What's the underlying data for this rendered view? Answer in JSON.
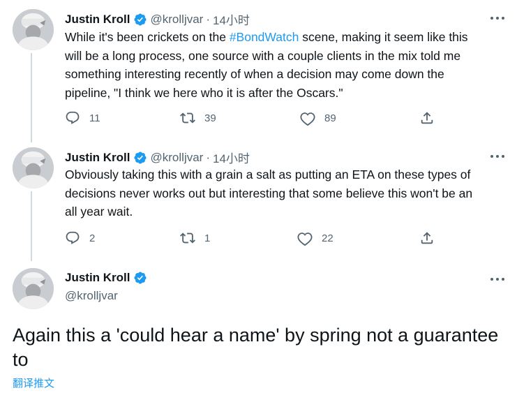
{
  "tweets": [
    {
      "name": "Justin Kroll",
      "handle": "@krolljvar",
      "dot": "·",
      "time": "14小时",
      "text_before": "While it's been crickets on the ",
      "hashtag": "#BondWatch",
      "text_after": " scene, making it seem like this\nwill be a long process, one source with a couple clients in the mix told me\nsomething interesting recently of when a decision may come down the\npipeline, \"I think we here who it is after the Oscars.\"",
      "replies": "11",
      "retweets": "39",
      "likes": "89"
    },
    {
      "name": "Justin Kroll",
      "handle": "@krolljvar",
      "dot": "·",
      "time": "14小时",
      "text": "Obviously taking this with a grain a salt as putting an ETA on these types of\ndecisions never works out but interesting that some believe this won't be an\nall year wait.",
      "replies": "2",
      "retweets": "1",
      "likes": "22"
    }
  ],
  "main_tweet": {
    "name": "Justin Kroll",
    "handle": "@krolljvar",
    "text": "Again this a 'could hear a name' by spring not a guarantee to",
    "translate": "翻译推文"
  },
  "icons": {
    "verified": "verified-badge-icon",
    "more": "more-dots-icon",
    "reply": "reply-icon",
    "retweet": "retweet-icon",
    "like": "heart-icon",
    "share": "share-icon"
  },
  "colors": {
    "accent": "#1d9bf0",
    "text": "#0f1419",
    "secondary": "#536471",
    "thread_line": "#cfd9de"
  }
}
